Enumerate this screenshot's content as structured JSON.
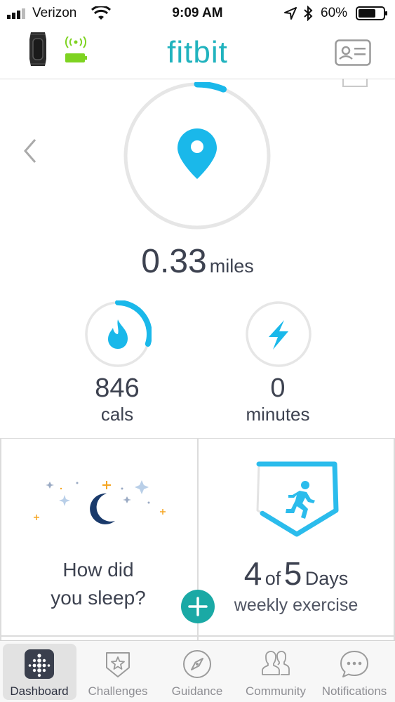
{
  "status_bar": {
    "carrier": "Verizon",
    "time": "9:09 AM",
    "battery": "60%"
  },
  "header": {
    "logo": "fitbit",
    "device_icon": "fitbit-tracker-icon",
    "sync_icon": "sync-status-icon",
    "profile_icon": "profile-card-icon"
  },
  "main_metric": {
    "value": "0.33",
    "unit": "miles",
    "icon": "location-pin-icon",
    "progress": 0.06
  },
  "metrics": [
    {
      "value": "846",
      "unit": "cals",
      "icon": "flame-icon",
      "progress": 0.3
    },
    {
      "value": "0",
      "unit": "minutes",
      "icon": "lightning-icon",
      "progress": 0
    }
  ],
  "tiles": {
    "sleep": {
      "text_line1": "How did",
      "text_line2": "you sleep?",
      "icon": "moon-stars-icon"
    },
    "exercise": {
      "count": "4",
      "of": "of",
      "total": "5",
      "period": "Days",
      "label": "weekly exercise",
      "icon": "runner-shield-icon",
      "progress": 0.8
    }
  },
  "add_button": {
    "icon": "plus-icon"
  },
  "tabs": [
    {
      "label": "Dashboard",
      "icon": "dashboard-icon",
      "active": true
    },
    {
      "label": "Challenges",
      "icon": "star-shield-icon",
      "active": false
    },
    {
      "label": "Guidance",
      "icon": "compass-icon",
      "active": false
    },
    {
      "label": "Community",
      "icon": "people-icon",
      "active": false
    },
    {
      "label": "Notifications",
      "icon": "speech-bubble-icon",
      "active": false
    }
  ],
  "colors": {
    "accent": "#21b3be",
    "ring_blue": "#1ab8ea",
    "ring_track": "#e6e6e6",
    "plus_button": "#1aa9a5",
    "battery_green": "#7ed321"
  }
}
